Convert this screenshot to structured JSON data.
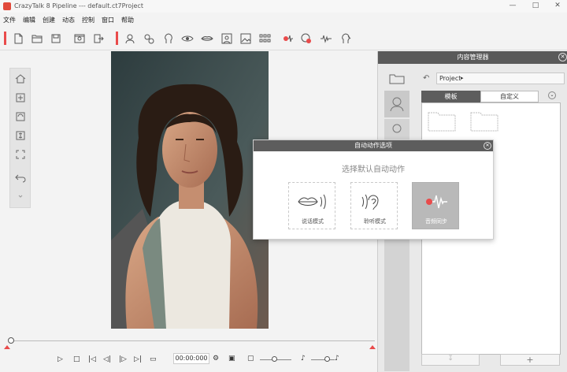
{
  "window": {
    "title": "CrazyTalk 8 Pipeline --- default.ct7Project",
    "controls": [
      "—",
      "□",
      "✕"
    ]
  },
  "menu": [
    "文件",
    "编辑",
    "创建",
    "动态",
    "控制",
    "窗口",
    "帮助"
  ],
  "timeline": {
    "timecode": "00:00:000"
  },
  "content_manager": {
    "title": "内容管理器",
    "path": "Project",
    "tabs": [
      "模板",
      "自定义"
    ],
    "active_tab": "模板"
  },
  "dialog": {
    "title": "自动动作选项",
    "prompt": "选择默认自动动作",
    "options": [
      {
        "label": "说话模式",
        "icon": "lips-sound-icon"
      },
      {
        "label": "聆听模式",
        "icon": "ear-sound-icon"
      },
      {
        "label": "音频同步",
        "icon": "audio-wave-icon"
      }
    ],
    "selected": "音频同步"
  },
  "colors": {
    "accent_red": "#e94b4b",
    "dialog_header": "#5d5d5d",
    "cm_header": "#5a5a5a"
  }
}
